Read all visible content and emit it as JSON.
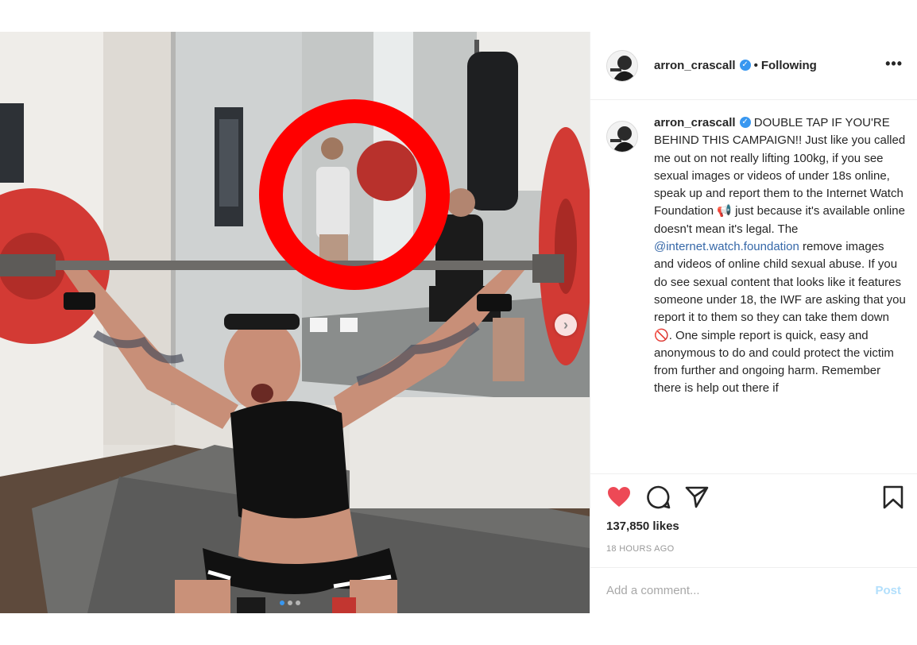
{
  "post": {
    "username": "arron_crascall",
    "verified_icon": "verified-badge-icon",
    "separator": "•",
    "follow_status": "Following",
    "more_label": "•••",
    "caption": {
      "username": "arron_crascall",
      "part1": " DOUBLE TAP IF YOU'RE BEHIND THIS CAMPAIGN!! Just like you called me out on not really lifting 100kg, if you see sexual images or videos of under 18s online, speak up and report them to the Internet Watch Foundation ",
      "megaphone": "📢",
      "part2": " just because it's available online doesn't mean it's legal. The ",
      "mention": "@internet.watch.foundation",
      "part3": " remove images and videos of online child sexual abuse. If you do see sexual content that looks like it features someone under 18, the IWF are asking that you report it to them so they can take them down ",
      "no_sign": "🚫",
      "part4": ". One simple report is quick, easy and anonymous to do and could protect the victim from further and ongoing harm. Remember there is help out there if"
    },
    "likes": "137,850 likes",
    "timestamp": "18 HOURS AGO",
    "comment_placeholder": "Add a comment...",
    "post_button": "Post",
    "carousel": {
      "next_label": "›",
      "slide_count": 3,
      "active_index": 0
    },
    "colors": {
      "like": "#ed4956",
      "link": "#3668a8",
      "verified": "#3897f0",
      "post_disabled": "#b2dffc",
      "highlight_ring": "#ff0000"
    }
  }
}
